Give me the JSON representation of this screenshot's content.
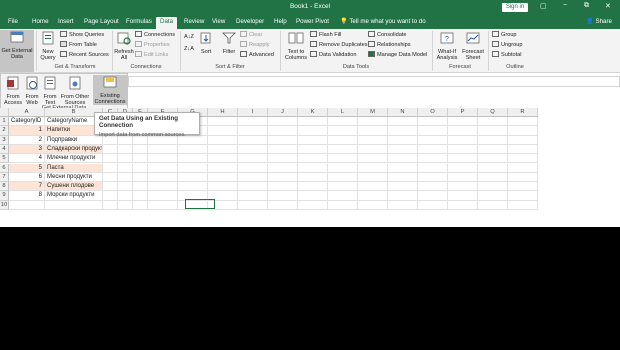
{
  "window": {
    "title": "Book1 - Excel",
    "signin": "Sign in",
    "min": "−",
    "restore": "▢",
    "close": "✕",
    "restore_down": "⧉"
  },
  "tabs": [
    "File",
    "Home",
    "Insert",
    "Page Layout",
    "Formulas",
    "Data",
    "Review",
    "View",
    "Developer",
    "Help",
    "Power Pivot"
  ],
  "active_tab": "Data",
  "tellme": "Tell me what you want to do",
  "share": "Share",
  "ribbon": {
    "get_external": "Get External Data",
    "new_query": "New Query",
    "show_queries": "Show Queries",
    "from_table": "From Table",
    "recent_sources": "Recent Sources",
    "get_transform": "Get & Transform",
    "refresh_all": "Refresh All",
    "connections": "Connections",
    "properties": "Properties",
    "edit_links": "Edit Links",
    "connections_group": "Connections",
    "sort_az": "A↓Z",
    "sort_za": "Z↓A",
    "sort": "Sort",
    "filter": "Filter",
    "clear": "Clear",
    "reapply": "Reapply",
    "advanced": "Advanced",
    "sort_filter": "Sort & Filter",
    "text_to_columns": "Text to Columns",
    "flash_fill": "Flash Fill",
    "remove_duplicates": "Remove Duplicates",
    "data_validation": "Data Validation",
    "consolidate": "Consolidate",
    "relationships": "Relationships",
    "manage_data_model": "Manage Data Model",
    "data_tools": "Data Tools",
    "what_if": "What-If Analysis",
    "forecast_sheet": "Forecast Sheet",
    "forecast": "Forecast",
    "group": "Group",
    "ungroup": "Ungroup",
    "subtotal": "Subtotal",
    "outline": "Outline"
  },
  "dropdown": {
    "from_access": "From Access",
    "from_web": "From Web",
    "from_text": "From Text",
    "from_other": "From Other Sources",
    "existing": "Existing Connections",
    "label": "Get External Data"
  },
  "tooltip": {
    "title": "Get Data Using an Existing Connection",
    "desc": "Import data from common sources."
  },
  "columns": [
    "A",
    "B",
    "C",
    "D",
    "E",
    "F",
    "G",
    "H",
    "I",
    "J",
    "K",
    "L",
    "M",
    "N",
    "O",
    "P",
    "Q",
    "R"
  ],
  "rows": [
    "1",
    "2",
    "3",
    "4",
    "5",
    "6",
    "7",
    "8",
    "9",
    "10"
  ],
  "table": {
    "headers": [
      "CategoryID",
      "CategoryName"
    ],
    "ids": [
      "1",
      "2",
      "3",
      "4",
      "5",
      "6",
      "7",
      "8"
    ],
    "names": [
      "Напитки",
      "Подправки",
      "Сладкарски продукти",
      "Млечни продукти",
      "Паста",
      "Месни продукти",
      "Сушени плодове",
      "Морски продукти"
    ]
  }
}
